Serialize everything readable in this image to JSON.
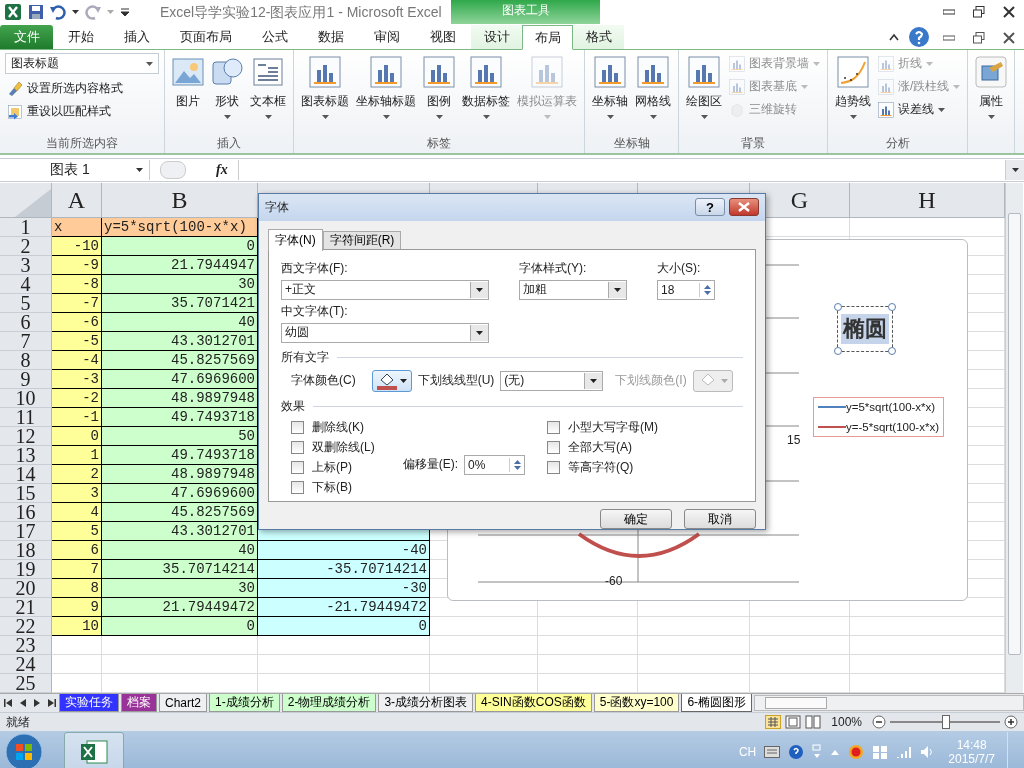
{
  "window": {
    "title": "Excel导学实验12-图表应用1  -  Microsoft Excel",
    "context_group": "图表工具"
  },
  "tabs": [
    {
      "label": "文件",
      "kind": "file",
      "selected": false
    },
    {
      "label": "开始",
      "kind": "normal",
      "selected": false
    },
    {
      "label": "插入",
      "kind": "normal",
      "selected": false
    },
    {
      "label": "页面布局",
      "kind": "normal",
      "selected": false
    },
    {
      "label": "公式",
      "kind": "normal",
      "selected": false
    },
    {
      "label": "数据",
      "kind": "normal",
      "selected": false
    },
    {
      "label": "审阅",
      "kind": "normal",
      "selected": false
    },
    {
      "label": "视图",
      "kind": "normal",
      "selected": false
    },
    {
      "label": "设计",
      "kind": "context",
      "selected": false
    },
    {
      "label": "布局",
      "kind": "context",
      "selected": true
    },
    {
      "label": "格式",
      "kind": "context",
      "selected": false
    }
  ],
  "ribbon": [
    {
      "label": "当前所选内容",
      "items": [
        {
          "label": "图表标题",
          "kind": "select",
          "disabled": false,
          "dropdown": true
        },
        {
          "label": "设置所选内容格式",
          "kind": "small",
          "disabled": false,
          "dropdown": false
        },
        {
          "label": "重设以匹配样式",
          "kind": "small",
          "disabled": false,
          "dropdown": false
        }
      ]
    },
    {
      "label": "插入",
      "items": [
        {
          "label": "图片",
          "kind": "large",
          "disabled": false,
          "dropdown": false
        },
        {
          "label": "形状",
          "kind": "large",
          "disabled": false,
          "dropdown": true
        },
        {
          "label": "文本框",
          "kind": "large",
          "disabled": false,
          "dropdown": true
        }
      ]
    },
    {
      "label": "标签",
      "items": [
        {
          "label": "图表标题",
          "kind": "large",
          "disabled": false,
          "dropdown": true
        },
        {
          "label": "坐标轴标题",
          "kind": "large",
          "disabled": false,
          "dropdown": true
        },
        {
          "label": "图例",
          "kind": "large",
          "disabled": false,
          "dropdown": true
        },
        {
          "label": "数据标签",
          "kind": "large",
          "disabled": false,
          "dropdown": true
        },
        {
          "label": "模拟运算表",
          "kind": "large",
          "disabled": true,
          "dropdown": true
        }
      ]
    },
    {
      "label": "坐标轴",
      "items": [
        {
          "label": "坐标轴",
          "kind": "large",
          "disabled": false,
          "dropdown": true
        },
        {
          "label": "网格线",
          "kind": "large",
          "disabled": false,
          "dropdown": true
        }
      ]
    },
    {
      "label": "背景",
      "items": [
        {
          "label": "绘图区",
          "kind": "large",
          "disabled": false,
          "dropdown": true
        },
        {
          "label": "图表背景墙",
          "kind": "small",
          "disabled": true,
          "dropdown": true
        },
        {
          "label": "图表基底",
          "kind": "small",
          "disabled": true,
          "dropdown": true
        },
        {
          "label": "三维旋转",
          "kind": "small",
          "disabled": true,
          "dropdown": false
        }
      ]
    },
    {
      "label": "分析",
      "items": [
        {
          "label": "趋势线",
          "kind": "large",
          "disabled": false,
          "dropdown": true
        },
        {
          "label": "折线",
          "kind": "small",
          "disabled": true,
          "dropdown": true
        },
        {
          "label": "涨/跌柱线",
          "kind": "small",
          "disabled": true,
          "dropdown": true
        },
        {
          "label": "误差线",
          "kind": "small",
          "disabled": false,
          "dropdown": true
        }
      ]
    },
    {
      "items": [
        {
          "label": "属性",
          "kind": "large",
          "disabled": false,
          "dropdown": true
        }
      ]
    }
  ],
  "formula_bar": {
    "name_box": "图表 1",
    "fx_label": "fx"
  },
  "sheet": {
    "column_headers": [
      "A",
      "B",
      "G",
      "H"
    ],
    "row_numbers": [
      "1",
      "2",
      "3",
      "4",
      "5",
      "6",
      "7",
      "8",
      "9",
      "10",
      "11",
      "12",
      "13",
      "14",
      "15",
      "16",
      "17",
      "18",
      "19",
      "20",
      "21",
      "22",
      "23",
      "24",
      "25"
    ],
    "rows": [
      {
        "kind": "header",
        "a": "x",
        "b": "y=5*sqrt(100-x*x)"
      },
      {
        "kind": "data",
        "a": "-10",
        "b": "0"
      },
      {
        "kind": "data",
        "a": "-9",
        "b": "21.7944947"
      },
      {
        "kind": "data",
        "a": "-8",
        "b": "30"
      },
      {
        "kind": "data",
        "a": "-7",
        "b": "35.7071421"
      },
      {
        "kind": "data",
        "a": "-6",
        "b": "40"
      },
      {
        "kind": "data",
        "a": "-5",
        "b": "43.3012701"
      },
      {
        "kind": "data",
        "a": "-4",
        "b": "45.8257569"
      },
      {
        "kind": "data",
        "a": "-3",
        "b": "47.6969600"
      },
      {
        "kind": "data",
        "a": "-2",
        "b": "48.9897948"
      },
      {
        "kind": "data",
        "a": "-1",
        "b": "49.7493718"
      },
      {
        "kind": "data",
        "a": "0",
        "b": "50"
      },
      {
        "kind": "data",
        "a": "1",
        "b": "49.7493718"
      },
      {
        "kind": "data",
        "a": "2",
        "b": "48.9897948"
      },
      {
        "kind": "data",
        "a": "3",
        "b": "47.6969600"
      },
      {
        "kind": "data",
        "a": "4",
        "b": "45.8257569"
      },
      {
        "kind": "data",
        "a": "5",
        "b": "43.3012701"
      },
      {
        "kind": "data",
        "a": "6",
        "b": "40",
        "c": "-40"
      },
      {
        "kind": "data",
        "a": "7",
        "b": "35.70714214",
        "c": "-35.70714214"
      },
      {
        "kind": "data",
        "a": "8",
        "b": "30",
        "c": "-30"
      },
      {
        "kind": "data",
        "a": "9",
        "b": "21.79449472",
        "c": "-21.79449472"
      },
      {
        "kind": "data",
        "a": "10",
        "b": "0",
        "c": "0"
      }
    ]
  },
  "chart": {
    "title": "椭圆",
    "title_selected": true,
    "axis_labels": [
      "15",
      "-60"
    ],
    "legend": [
      {
        "label": "y=5*sqrt(100-x*x)",
        "color": "#4f81bd"
      },
      {
        "label": "y=-5*sqrt(100-x*x)",
        "color": "#c0504d"
      }
    ]
  },
  "dialog": {
    "title": "字体",
    "help": "?",
    "tabs": [
      {
        "label": "字体(N)",
        "selected": true
      },
      {
        "label": "字符间距(R)",
        "selected": false
      }
    ],
    "latin_font": {
      "label": "西文字体(F):",
      "value": "+正文"
    },
    "style": {
      "label": "字体样式(Y):",
      "value": "加粗"
    },
    "size": {
      "label": "大小(S):",
      "value": "18"
    },
    "cjk_font": {
      "label": "中文字体(T):",
      "value": "幼圆"
    },
    "all_text": {
      "heading": "所有文字",
      "font_color_label": "字体颜色(C)",
      "underline_label": "下划线线型(U)",
      "underline_value": "(无)",
      "underline_color_label": "下划线颜色(I)",
      "underline_color_disabled": true
    },
    "effects": {
      "heading": "效果",
      "options": [
        {
          "label": "删除线(K)",
          "checked": false
        },
        {
          "label": "双删除线(L)",
          "checked": false
        },
        {
          "label": "上标(P)",
          "checked": false
        },
        {
          "label": "下标(B)",
          "checked": false
        },
        {
          "label": "小型大写字母(M)",
          "checked": false
        },
        {
          "label": "全部大写(A)",
          "checked": false
        },
        {
          "label": "等高字符(Q)",
          "checked": false
        }
      ],
      "offset": {
        "label": "偏移量(E):",
        "value": "0%"
      }
    },
    "buttons": [
      "确定",
      "取消"
    ]
  },
  "sheet_tabs": [
    {
      "label": "实验任务",
      "color": "#3333ff",
      "selected": false
    },
    {
      "label": "档案",
      "color": "#993399",
      "selected": false
    },
    {
      "label": "Chart2",
      "selected": false
    },
    {
      "label": "1-成绩分析",
      "color": "#ccffcc",
      "selected": false
    },
    {
      "label": "2-物理成绩分析",
      "color": "#ccffcc",
      "selected": false
    },
    {
      "label": "3-成绩分析图表",
      "selected": false
    },
    {
      "label": "4-SIN函数COS函数",
      "color": "#ffff99",
      "selected": false
    },
    {
      "label": "5-函数xy=100",
      "color": "#ffffcc",
      "selected": false
    },
    {
      "label": "6-椭圆图形",
      "selected": true
    }
  ],
  "status_bar": {
    "text": "就绪",
    "zoom": "100%",
    "level": 0.5
  },
  "taskbar": {
    "language": "CH",
    "time": "14:48",
    "date": "2015/7/7"
  }
}
